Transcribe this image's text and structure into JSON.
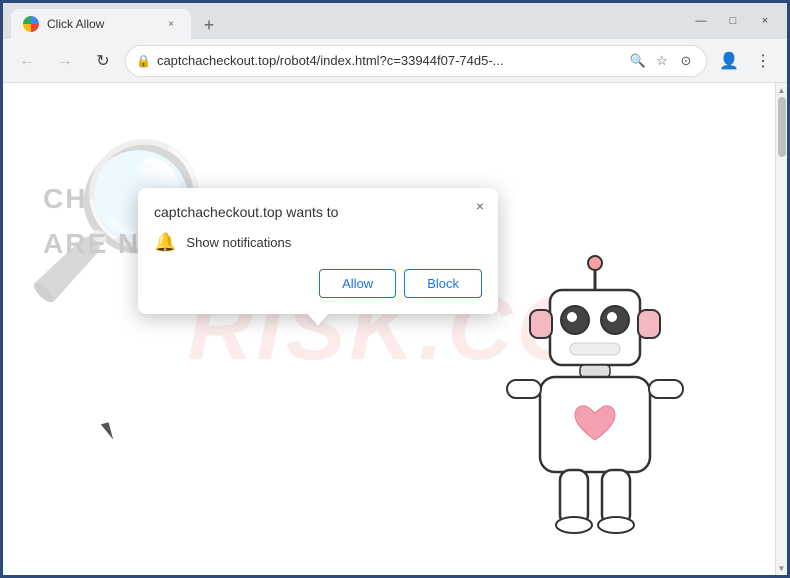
{
  "browser": {
    "title": "Click Allow",
    "tab": {
      "title": "Click Allow",
      "close_label": "×"
    },
    "new_tab_label": "+",
    "window_controls": {
      "minimize": "—",
      "maximize": "□",
      "close": "×"
    }
  },
  "toolbar": {
    "back_arrow": "←",
    "forward_arrow": "→",
    "reload": "↻",
    "address": "captchacheckout.top/robot4/index.html?c=33944f07-74d5-...",
    "address_lock": "🔒",
    "search_icon": "🔍",
    "bookmark_icon": "☆",
    "account_icon": "👤",
    "menu_icon": "⋮",
    "profile_icon": "⊙"
  },
  "notification_popup": {
    "title": "captchacheckout.top wants to",
    "notification_text": "Show notifications",
    "bell_icon": "🔔",
    "allow_button": "Allow",
    "block_button": "Block",
    "close_icon": "×"
  },
  "page": {
    "captcha_text_1": "CH",
    "captcha_text_2": "ARE NOT A ROBOT.",
    "watermark_text": "RISK.CO"
  }
}
